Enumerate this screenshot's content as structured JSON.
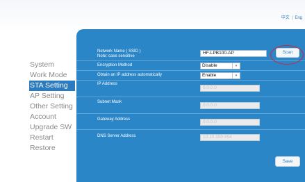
{
  "header": {
    "lang_zh": "中文",
    "lang_en": "Eng"
  },
  "sidebar": {
    "items": [
      {
        "label": "System"
      },
      {
        "label": "Work Mode"
      },
      {
        "label": "STA Setting"
      },
      {
        "label": "AP Setting"
      },
      {
        "label": "Other Setting"
      },
      {
        "label": "Account"
      },
      {
        "label": "Upgrade SW"
      },
      {
        "label": "Restart"
      },
      {
        "label": "Restore"
      }
    ],
    "active": "STA Setting"
  },
  "form": {
    "ssid_label": "Network Name ( SSID )",
    "ssid_note": "Note: case sensitive",
    "ssid_value": "HF-LPB100-AP",
    "scan_label": "Scan",
    "encryption_label": "Encryption Method",
    "encryption_value": "Disable",
    "auto_ip_label": "Obtain an IP address automatically",
    "auto_ip_value": "Enable",
    "ip_label": "IP Address",
    "ip_value": "0.0.0.0",
    "mask_label": "Subnet Mask",
    "mask_value": "0.0.0.0",
    "gateway_label": "Gateway Address",
    "gateway_value": "0.0.0.0",
    "dns_label": "DNS Server Address",
    "dns_value": "10.10.100.254",
    "save_label": "Save"
  },
  "colors": {
    "accent": "#2b86c8",
    "nav_active": "#2b7bc0",
    "highlight": "#d2233c"
  }
}
